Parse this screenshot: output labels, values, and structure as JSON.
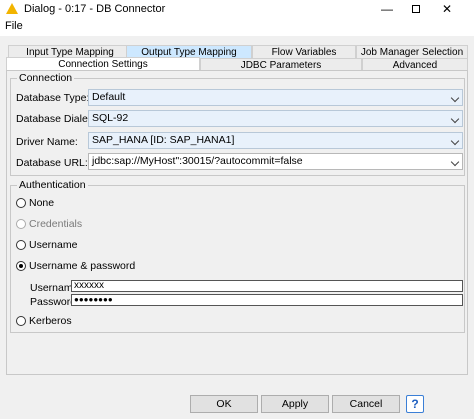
{
  "window": {
    "title": "Dialog - 0:17 - DB Connector",
    "minimize": "—",
    "close": "✕"
  },
  "menu": {
    "file": "File"
  },
  "tabs": {
    "row1": [
      "Input Type Mapping",
      "Output Type Mapping",
      "Flow Variables",
      "Job Manager Selection"
    ],
    "row2": [
      "Connection Settings",
      "JDBC Parameters",
      "Advanced"
    ]
  },
  "connection": {
    "title": "Connection",
    "database_type_label": "Database Type:",
    "database_type_value": "Default",
    "dialect_label": "Database Dialect:",
    "dialect_value": "SQL-92",
    "driver_label": "Driver Name:",
    "driver_value": "SAP_HANA [ID: SAP_HANA1]",
    "url_label": "Database URL:",
    "url_value": "jdbc:sap://MyHost\":30015/?autocommit=false"
  },
  "auth": {
    "title": "Authentication",
    "none": "None",
    "credentials": "Credentials",
    "username": "Username",
    "username_password": "Username & password",
    "username_field_label": "Username:",
    "username_field_value": "xxxxxx",
    "password_field_label": "Password:",
    "password_field_value": "●●●●●●●●",
    "kerberos": "Kerberos"
  },
  "buttons": {
    "ok": "OK",
    "apply": "Apply",
    "cancel": "Cancel",
    "help": "?"
  }
}
